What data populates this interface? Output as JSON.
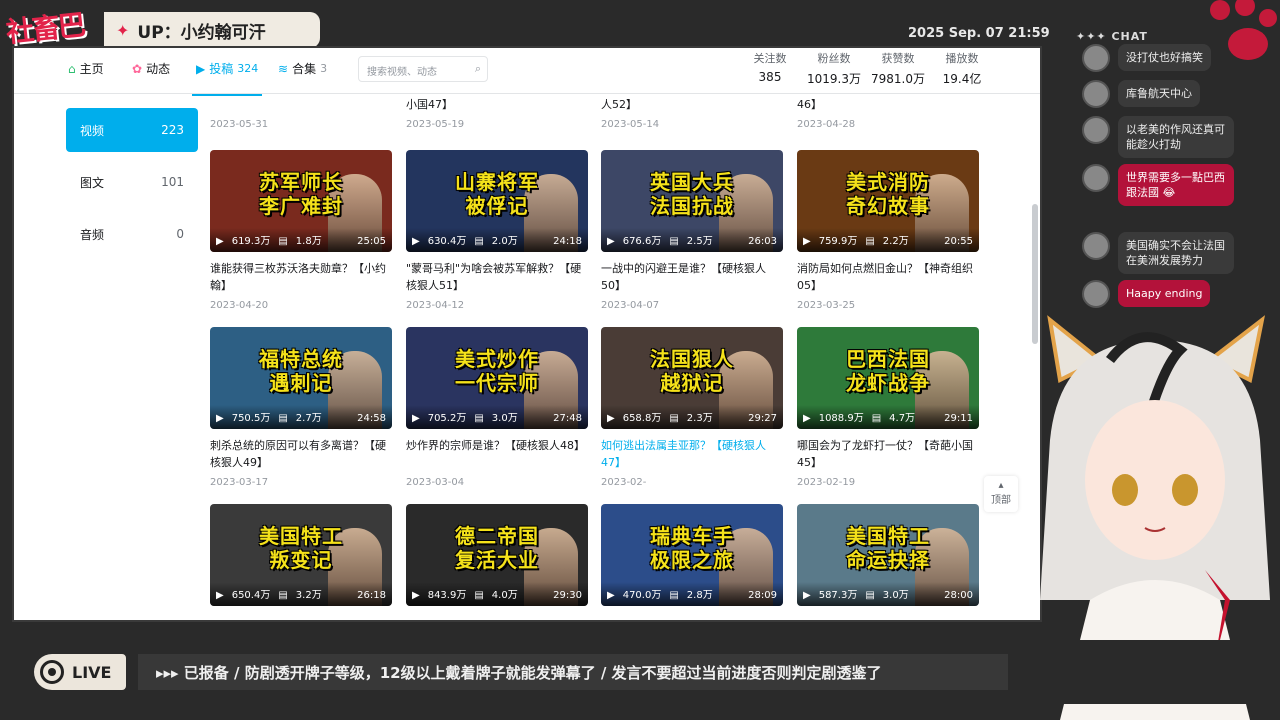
{
  "overlay": {
    "logo_text": "社畜巴",
    "up_name": "UP：小约翰可汗",
    "datetime": "2025 Sep. 07 21:59",
    "chat_header": "✦✦✦ CHAT"
  },
  "nav": {
    "tabs": [
      {
        "label": "主页",
        "count": "",
        "icon": "home-icon"
      },
      {
        "label": "动态",
        "count": "",
        "icon": "dynamic-icon"
      },
      {
        "label": "投稿",
        "count": "324",
        "icon": "upload-icon"
      },
      {
        "label": "合集",
        "count": "3",
        "icon": "collection-icon"
      }
    ],
    "search_placeholder": "搜索视频、动态",
    "stats": [
      {
        "label": "关注数",
        "value": "385"
      },
      {
        "label": "粉丝数",
        "value": "1019.3万"
      },
      {
        "label": "获赞数",
        "value": "7981.0万"
      },
      {
        "label": "播放数",
        "value": "19.4亿"
      }
    ]
  },
  "sidebar": [
    {
      "label": "视频",
      "count": "223"
    },
    {
      "label": "图文",
      "count": "101"
    },
    {
      "label": "音频",
      "count": "0"
    }
  ],
  "partial_row": [
    {
      "desc": "",
      "date": "2023-05-31"
    },
    {
      "desc": "小国47】",
      "date": "2023-05-19"
    },
    {
      "desc": "人52】",
      "date": "2023-05-14"
    },
    {
      "desc": "46】",
      "date": "2023-04-28"
    }
  ],
  "videos": [
    {
      "thumb_title": "苏军师长\n李广难封",
      "views": "619.3万",
      "danmaku": "1.8万",
      "duration": "25:05",
      "desc": "谁能获得三枚苏沃洛夫勋章？【小约翰】",
      "date": "2023-04-20",
      "bg": "#7a2a1e"
    },
    {
      "thumb_title": "山寨将军\n被俘记",
      "views": "630.4万",
      "danmaku": "2.0万",
      "duration": "24:18",
      "desc": "\"蒙哥马利\"为啥会被苏军解救？【硬核狠人51】",
      "date": "2023-04-12",
      "bg": "#23355e"
    },
    {
      "thumb_title": "英国大兵\n法国抗战",
      "views": "676.6万",
      "danmaku": "2.5万",
      "duration": "26:03",
      "desc": "一战中的闪避王是谁？【硬核狠人50】",
      "date": "2023-04-07",
      "bg": "#3d4766"
    },
    {
      "thumb_title": "美式消防\n奇幻故事",
      "views": "759.9万",
      "danmaku": "2.2万",
      "duration": "20:55",
      "desc": "消防局如何点燃旧金山？【神奇组织05】",
      "date": "2023-03-25",
      "bg": "#6a3a14"
    },
    {
      "thumb_title": "福特总统\n遇刺记",
      "views": "750.5万",
      "danmaku": "2.7万",
      "duration": "24:58",
      "desc": "刺杀总统的原因可以有多离谱？【硬核狠人49】",
      "date": "2023-03-17",
      "bg": "#2d5f84"
    },
    {
      "thumb_title": "美式炒作\n一代宗师",
      "views": "705.2万",
      "danmaku": "3.0万",
      "duration": "27:48",
      "desc": "炒作界的宗师是谁？【硬核狠人48】",
      "date": "2023-03-04",
      "bg": "#2a3460"
    },
    {
      "thumb_title": "法国狠人\n越狱记",
      "views": "658.8万",
      "danmaku": "2.3万",
      "duration": "29:27",
      "desc": "如何逃出法属圭亚那？【硬核狠人47】",
      "date": "2023-02-",
      "bg": "#4a3c36",
      "highlight": true
    },
    {
      "thumb_title": "巴西法国\n龙虾战争",
      "views": "1088.9万",
      "danmaku": "4.7万",
      "duration": "29:11",
      "desc": "哪国会为了龙虾打一仗？【奇葩小国45】",
      "date": "2023-02-19",
      "bg": "#2e7a3a"
    },
    {
      "thumb_title": "美国特工\n叛变记",
      "views": "650.4万",
      "danmaku": "3.2万",
      "duration": "26:18",
      "desc": "",
      "date": "",
      "bg": "#3a3a3a"
    },
    {
      "thumb_title": "德二帝国\n复活大业",
      "views": "843.9万",
      "danmaku": "4.0万",
      "duration": "29:30",
      "desc": "",
      "date": "",
      "bg": "#2a2a2a"
    },
    {
      "thumb_title": "瑞典车手\n极限之旅",
      "views": "470.0万",
      "danmaku": "2.8万",
      "duration": "28:09",
      "desc": "",
      "date": "",
      "bg": "#2c4d8a"
    },
    {
      "thumb_title": "美国特工\n命运抉择",
      "views": "587.3万",
      "danmaku": "3.0万",
      "duration": "28:00",
      "desc": "",
      "date": "",
      "bg": "#5a7a8a"
    }
  ],
  "back_to_top": "顶部",
  "chat": [
    {
      "text": "没打仗也好搞笑",
      "red": false
    },
    {
      "text": "库鲁航天中心",
      "red": false
    },
    {
      "text": "以老美的作风还真可能趁火打劫",
      "red": false
    },
    {
      "text": "世界需要多一點巴西跟法國 😂",
      "red": true
    },
    {
      "text": "美国确实不会让法国在美洲发展势力",
      "red": false
    },
    {
      "text": "Haapy ending",
      "red": true
    }
  ],
  "bottom": {
    "live_label": "LIVE",
    "ticker": "▸▸▸  已报备  /  防剧透开牌子等级，12级以上戴着牌子就能发弹幕了  /  发言不要超过当前进度否则判定剧透鉴了"
  },
  "colors": {
    "accent": "#00aeec",
    "brand_red": "#e2234a"
  }
}
